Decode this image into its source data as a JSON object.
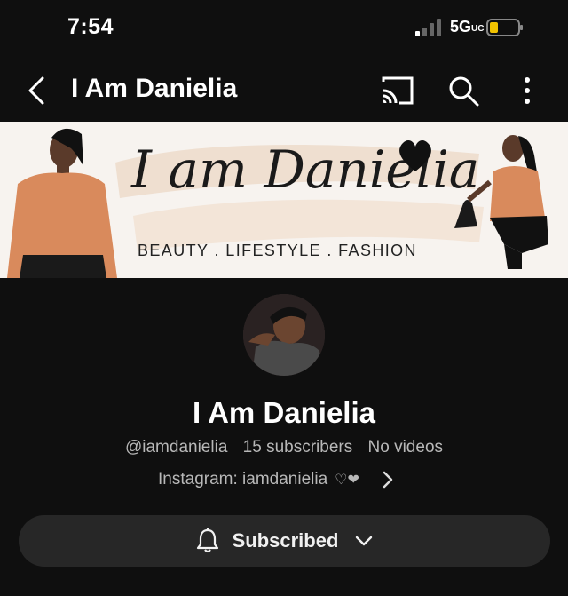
{
  "status_bar": {
    "time": "7:54",
    "network": "5G",
    "network_sub": "UC"
  },
  "app_bar": {
    "title": "I Am Danielia",
    "icons": [
      "back-arrow-icon",
      "cast-icon",
      "search-icon",
      "more-vert-icon"
    ]
  },
  "banner": {
    "script_text": "I am Danielia",
    "tagline": "BEAUTY . LIFESTYLE . FASHION"
  },
  "channel": {
    "name": "I Am Danielia",
    "handle": "@iamdanielia",
    "subscribers": "15 subscribers",
    "videos": "No videos",
    "link_text": "Instagram: iamdanielia",
    "link_emoji": "♡❤"
  },
  "subscribe_button": {
    "label": "Subscribed"
  },
  "colors": {
    "background": "#0f0f0f",
    "button_bg": "#272727",
    "banner_bg": "#f7f3ef",
    "accent_orange": "#d98a5c"
  }
}
